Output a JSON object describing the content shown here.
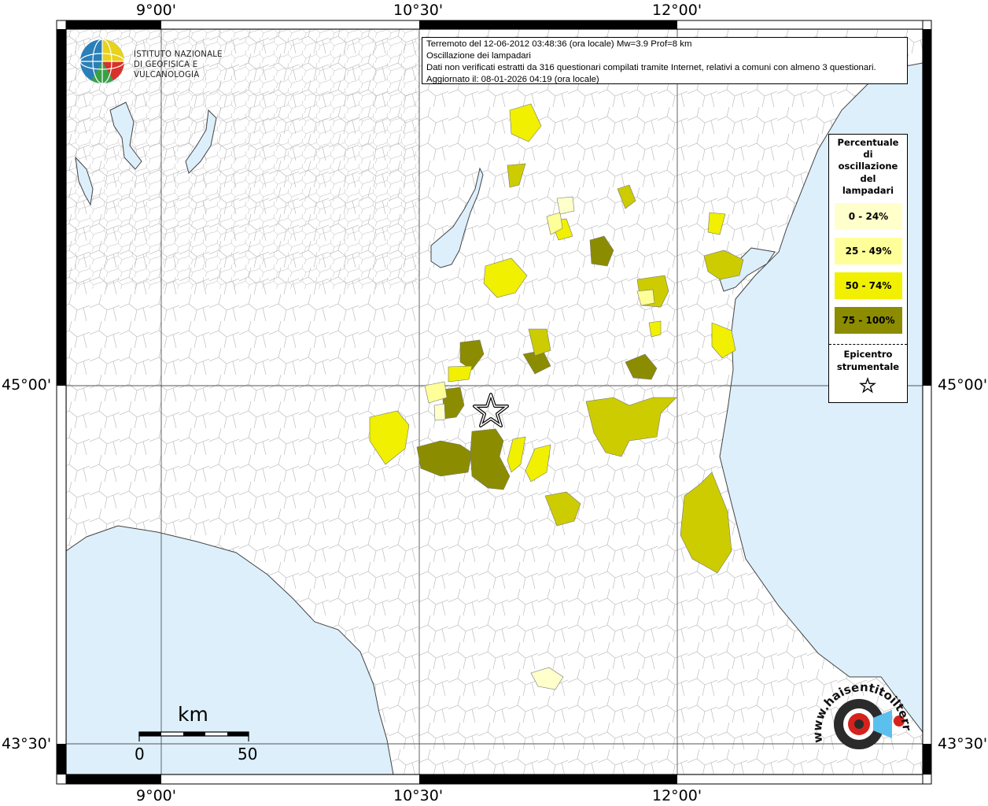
{
  "info": {
    "line1": "Terremoto del 12-06-2012 03:48:36 (ora locale) Mw=3.9 Prof=8 km",
    "line2": "Oscillazione dei lampadari",
    "line3": "Dati non verificati estratti da 316 questionari compilati tramite Internet, relativi a comuni con almeno 3 questionari.",
    "line4": "Aggiornato il: 08-01-2026 04:19 (ora locale)"
  },
  "axes": {
    "top": [
      "9°00'",
      "10°30'",
      "12°00'"
    ],
    "bottom": [
      "9°00'",
      "10°30'",
      "12°00'"
    ],
    "left": [
      "45°00'",
      "43°30'"
    ],
    "right": [
      "45°00'",
      "43°30'"
    ]
  },
  "logo": {
    "line1": "ISTITUTO NAZIONALE",
    "line2": "DI GEOFISICA E VULCANOLOGIA"
  },
  "legend": {
    "title_lines": [
      "Percentuale",
      "di",
      "oscillazione",
      "del",
      "lampadari"
    ],
    "classes": [
      {
        "label": "0 - 24%",
        "color": "#FFFFCC"
      },
      {
        "label": "25 - 49%",
        "color": "#FFFF99"
      },
      {
        "label": "50 - 74%",
        "color": "#FFFF00"
      },
      {
        "label": "75 - 100%",
        "color": "#8C8C00"
      }
    ],
    "epicenter_lines": [
      "Epicentro",
      "strumentale"
    ]
  },
  "scale": {
    "unit": "km",
    "min": "0",
    "max": "50"
  },
  "brand": {
    "text": "www.haisentitoilterremoto.it"
  },
  "colors": {
    "sea": "#DDEFFB",
    "land": "#FFFFFF",
    "boundaries": "#999999",
    "class_0_24": "#FFFFCC",
    "class_25_49": "#FFFF99",
    "class_50_74": "#F0F000",
    "class_75_100": "#8C8C00",
    "mid_olive": "#CCCC00"
  }
}
